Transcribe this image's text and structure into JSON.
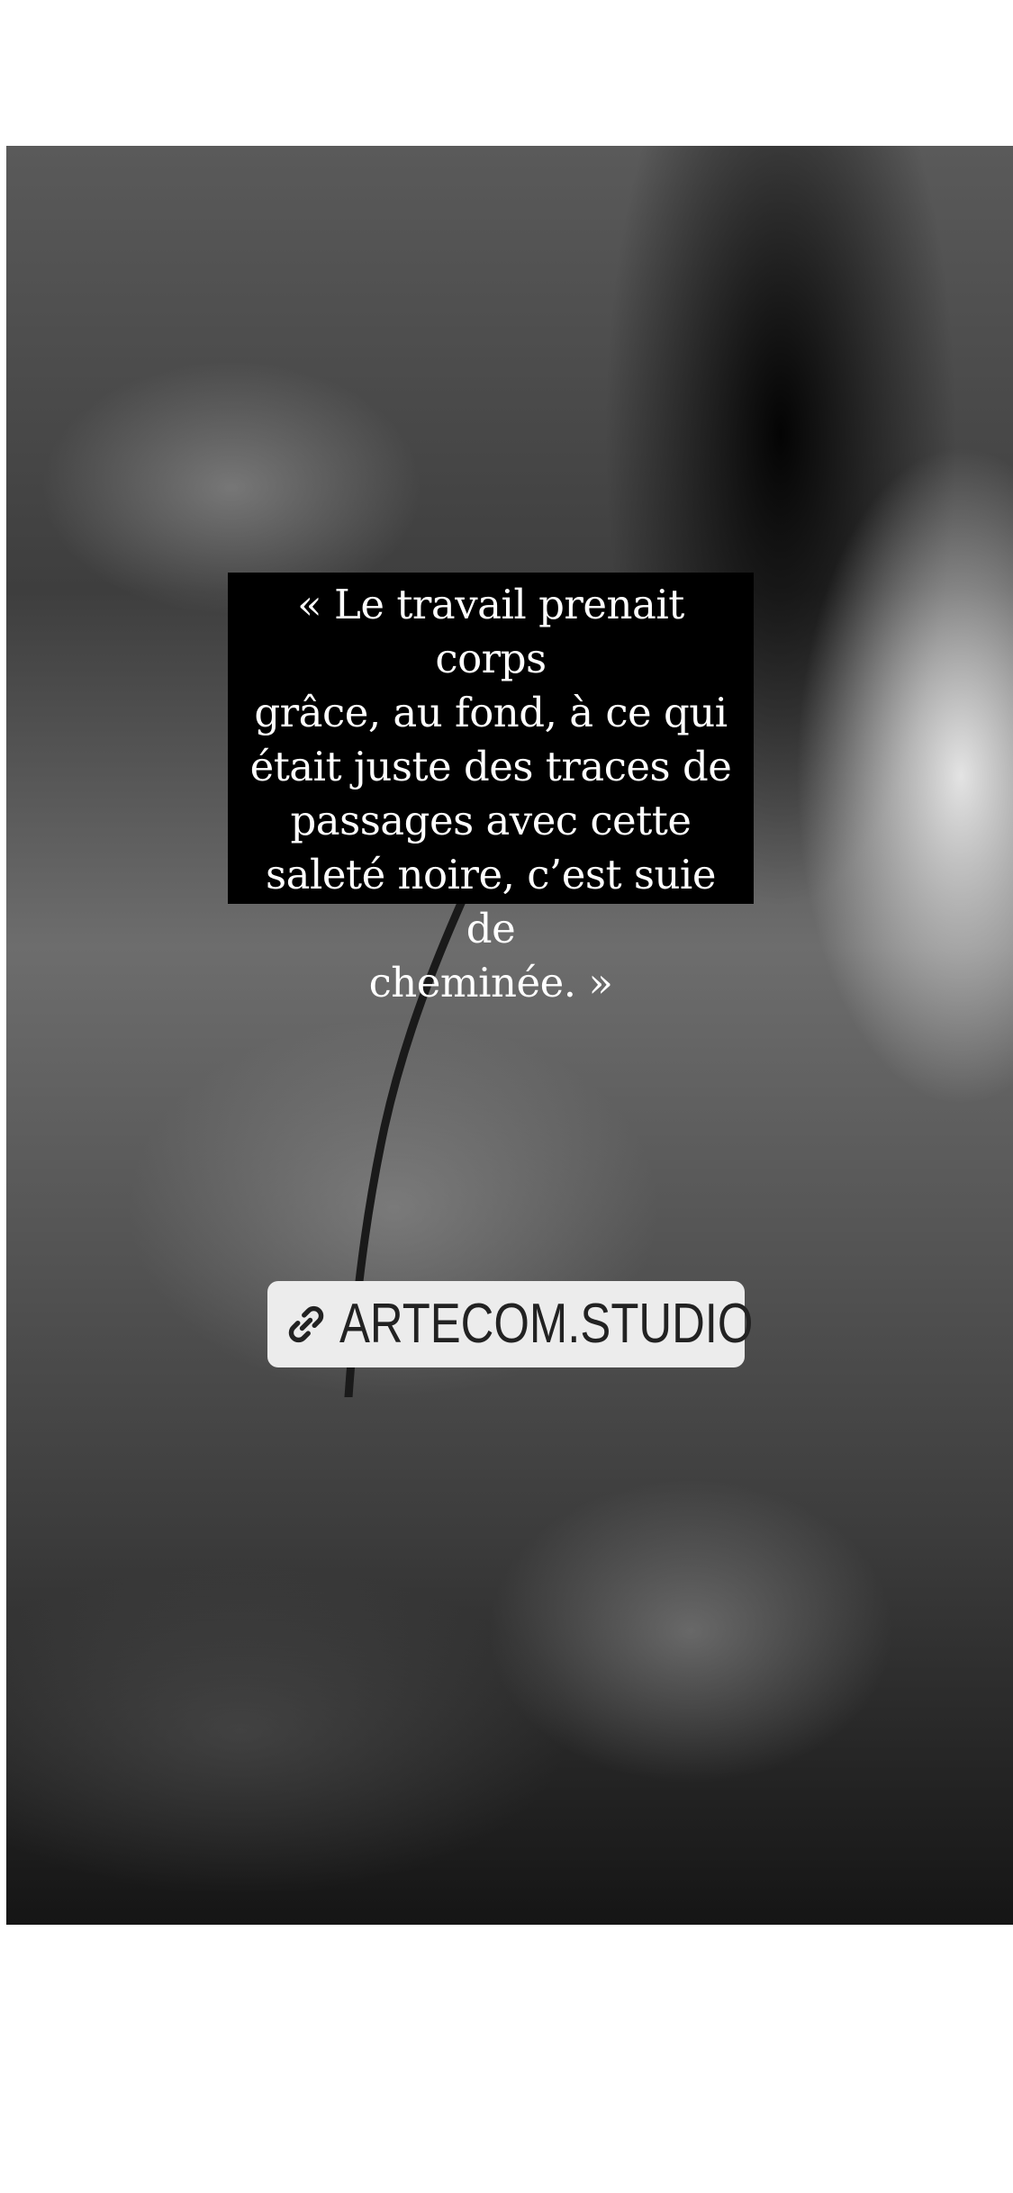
{
  "story": {
    "quote": "« Le travail prenait corps grâce, au fond, à ce qui était juste des traces de passages avec cette saleté noire, c’est suie de cheminée.   »",
    "quote_lines": [
      "« Le travail prenait corps",
      "grâce, au fond, à ce qui",
      "était juste des traces de",
      "passages avec cette",
      "saleté noire, c’est suie de",
      "cheminée.   »"
    ],
    "link": {
      "icon": "link-icon",
      "label": "ARTECOM.STUDIO"
    }
  },
  "colors": {
    "background": "#ffffff",
    "quote_box": "#000000",
    "quote_text": "#ffffff",
    "sticker_bg": "#ececec",
    "sticker_text": "#222222"
  }
}
